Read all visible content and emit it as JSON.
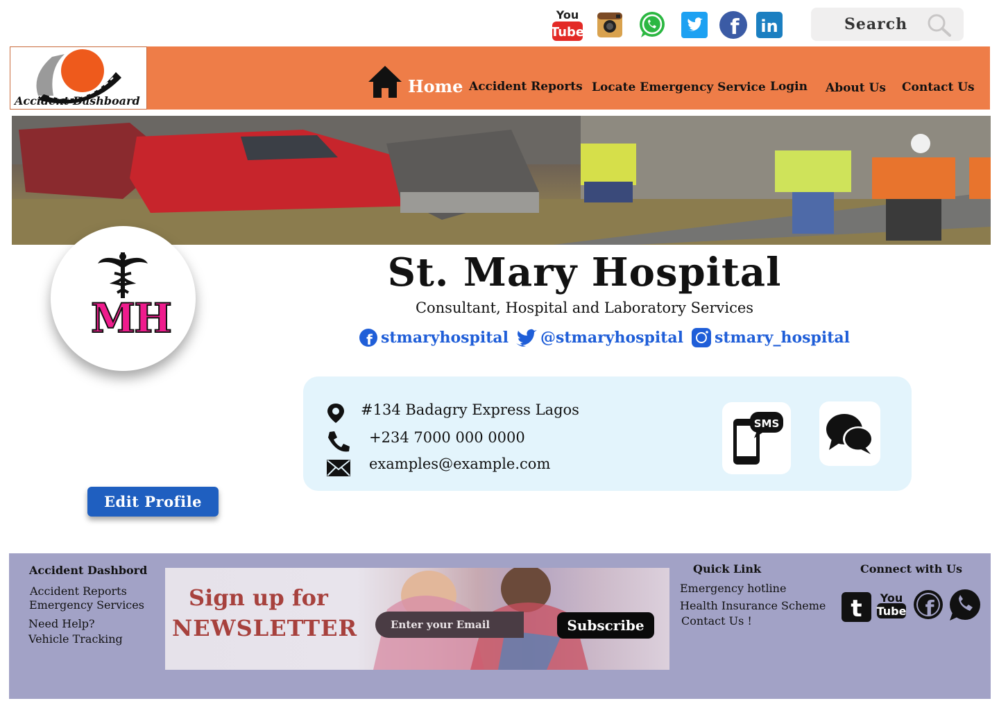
{
  "search": {
    "label": "Search"
  },
  "social_top": [
    "youtube-icon",
    "instagram-icon",
    "whatsapp-icon",
    "twitter-icon",
    "facebook-icon",
    "linkedin-icon"
  ],
  "brand": {
    "logo_text": "Accident Dashboard"
  },
  "nav": {
    "home": "Home",
    "items": [
      "Accident Reports",
      "Locate Emergency Service",
      "Login",
      "About Us",
      "Contact Us"
    ]
  },
  "profile": {
    "initials": "MH",
    "name": "St. Mary Hospital",
    "subtitle": "Consultant, Hospital and Laboratory Services",
    "facebook": "stmaryhospital",
    "twitter": "@stmaryhospital",
    "instagram": "stmary_hospital",
    "edit_label": "Edit Profile"
  },
  "contact": {
    "address": "#134 Badagry Express Lagos",
    "phone": "+234 7000 000 0000",
    "email": "examples@example.com"
  },
  "footer": {
    "brand_heading": "Accident Dashbord",
    "links_left": [
      "Accident Reports",
      "Emergency Services",
      "Need Help?",
      "Vehicle Tracking"
    ],
    "newsletter_line1": "Sign up for",
    "newsletter_line2": "NEWSLETTER",
    "email_placeholder": "Enter your Email",
    "subscribe_label": "Subscribe",
    "quick_link_heading": "Quick Link",
    "quick_links": [
      "Emergency hotline",
      "Health Insurance Scheme",
      "Contact Us !"
    ],
    "connect_heading": "Connect with Us",
    "connect_icons": [
      "tumblr-icon",
      "youtube-icon",
      "facebook-icon",
      "whatsapp-icon"
    ]
  },
  "colors": {
    "nav_bg": "#ee7d48",
    "footer_bg": "#a2a2c6",
    "card_bg": "#e3f4fc",
    "link_blue": "#1f5ed8",
    "button_blue": "#1f5fc0"
  }
}
